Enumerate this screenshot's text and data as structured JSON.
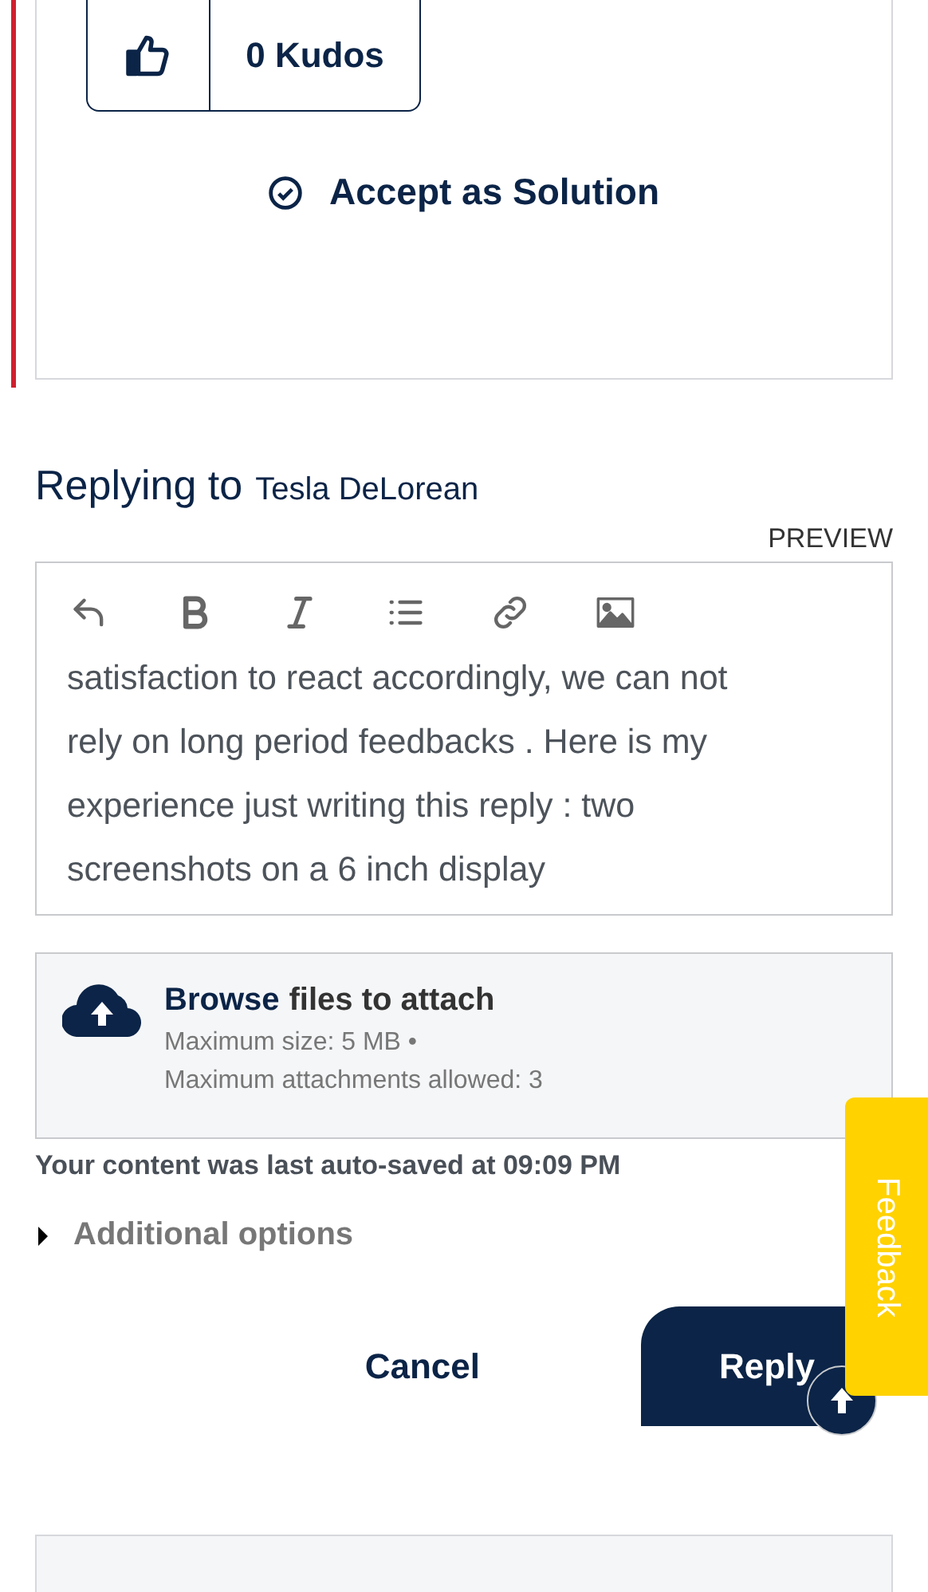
{
  "post": {
    "kudos": "0 Kudos",
    "accept_solution": "Accept as Solution"
  },
  "reply": {
    "heading": "Replying to",
    "recipient": "Tesla DeLorean",
    "preview": "PREVIEW",
    "body": "satisfaction to react accordingly, we can not rely on long period feedbacks . Here is my experience just writing this reply : two screenshots on a 6 inch display",
    "attach": {
      "link": "Browse",
      "label": "files to attach",
      "limits": [
        "Maximum size: 5 MB •",
        "Maximum attachments allowed: 3"
      ]
    },
    "autosave": "Your content was last auto-saved at 09:09 PM",
    "additional_options": {
      "label": "Additional options",
      "expanded": false
    },
    "cancel": "Cancel",
    "submit": "Reply"
  },
  "feedback": "Feedback"
}
